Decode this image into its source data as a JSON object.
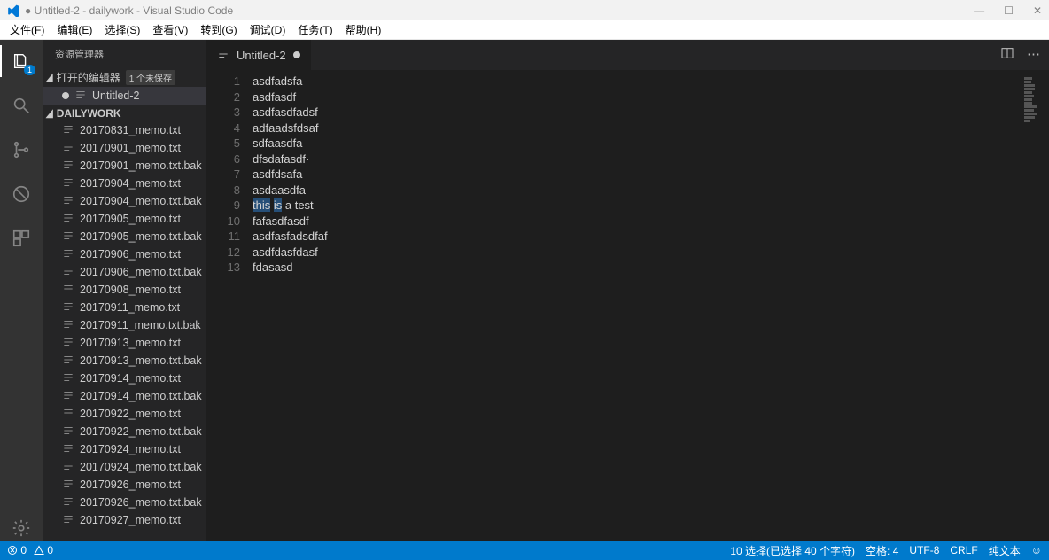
{
  "window": {
    "title": "● Untitled-2 - dailywork - Visual Studio Code"
  },
  "menu": [
    "文件(F)",
    "编辑(E)",
    "选择(S)",
    "查看(V)",
    "转到(G)",
    "调试(D)",
    "任务(T)",
    "帮助(H)"
  ],
  "activity": {
    "explorer_badge": "1"
  },
  "sidebar": {
    "title": "资源管理器",
    "open_editors_label": "打开的编辑器",
    "unsaved_label": "1 个未保存",
    "open_editor_file": "Untitled-2",
    "folder_name": "DAILYWORK",
    "files": [
      "20170831_memo.txt",
      "20170901_memo.txt",
      "20170901_memo.txt.bak",
      "20170904_memo.txt",
      "20170904_memo.txt.bak",
      "20170905_memo.txt",
      "20170905_memo.txt.bak",
      "20170906_memo.txt",
      "20170906_memo.txt.bak",
      "20170908_memo.txt",
      "20170911_memo.txt",
      "20170911_memo.txt.bak",
      "20170913_memo.txt",
      "20170913_memo.txt.bak",
      "20170914_memo.txt",
      "20170914_memo.txt.bak",
      "20170922_memo.txt",
      "20170922_memo.txt.bak",
      "20170924_memo.txt",
      "20170924_memo.txt.bak",
      "20170926_memo.txt",
      "20170926_memo.txt.bak",
      "20170927_memo.txt"
    ]
  },
  "tab": {
    "title": "Untitled-2"
  },
  "code": [
    "asdfadsfa",
    "asdfasdf",
    "asdfasdfadsf",
    "adfaadsfdsaf",
    "sdfaasdfa",
    "dfsdafasdf·",
    "asdfdsafa",
    "asdaasdfa",
    "this is a test",
    "fafasdfasdf",
    "asdfasfadsdfaf",
    "asdfdasfdasf",
    "fdasasd"
  ],
  "status": {
    "errors": "0",
    "warnings": "0",
    "selection": "10 选择(已选择 40 个字符)",
    "spaces": "空格: 4",
    "encoding": "UTF-8",
    "eol": "CRLF",
    "lang": "纯文本"
  }
}
